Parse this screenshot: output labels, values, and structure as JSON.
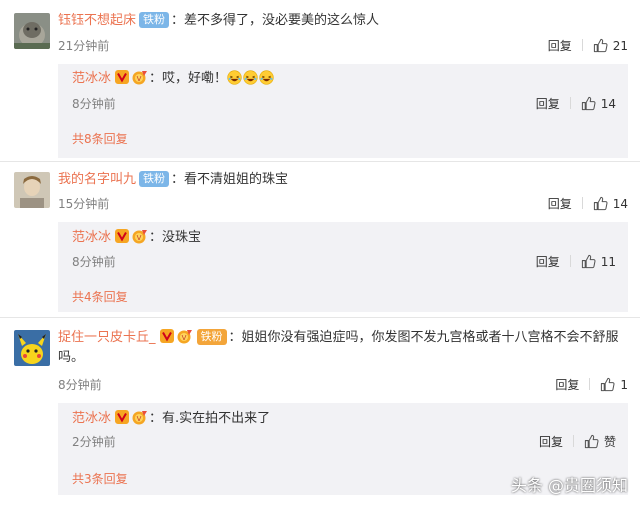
{
  "fan_badge": "铁粉",
  "reply_label": "回复",
  "comments": [
    {
      "user": "钰钰不想起床",
      "text": "差不多得了，没必要美的这么惊人",
      "time": "21分钟前",
      "likes": "21",
      "reply": {
        "user": "范冰冰",
        "text": "哎，好嘞！",
        "time": "8分钟前",
        "likes": "14"
      },
      "more": "共8条回复"
    },
    {
      "user": "我的名字叫九",
      "text": "看不清姐姐的珠宝",
      "time": "15分钟前",
      "likes": "14",
      "reply": {
        "user": "范冰冰",
        "text": "没珠宝",
        "time": "8分钟前",
        "likes": "11"
      },
      "more": "共4条回复"
    },
    {
      "user": "捉住一只皮卡丘_",
      "text_line1": "姐姐你没有强迫症吗，你发图不发九宫格或者十八宫格不会不舒服",
      "text_line2": "吗。",
      "time": "8分钟前",
      "likes": "1",
      "reply": {
        "user": "范冰冰",
        "text": "有.实在拍不出来了",
        "time": "2分钟前",
        "likes": "赞"
      },
      "more": "共3条回复"
    }
  ],
  "watermark": "头条 @贵圈须知",
  "colors": {
    "username": "#eb7350",
    "fan_badge": "#7cb6e8",
    "reply_bg": "#f2f2f5"
  }
}
